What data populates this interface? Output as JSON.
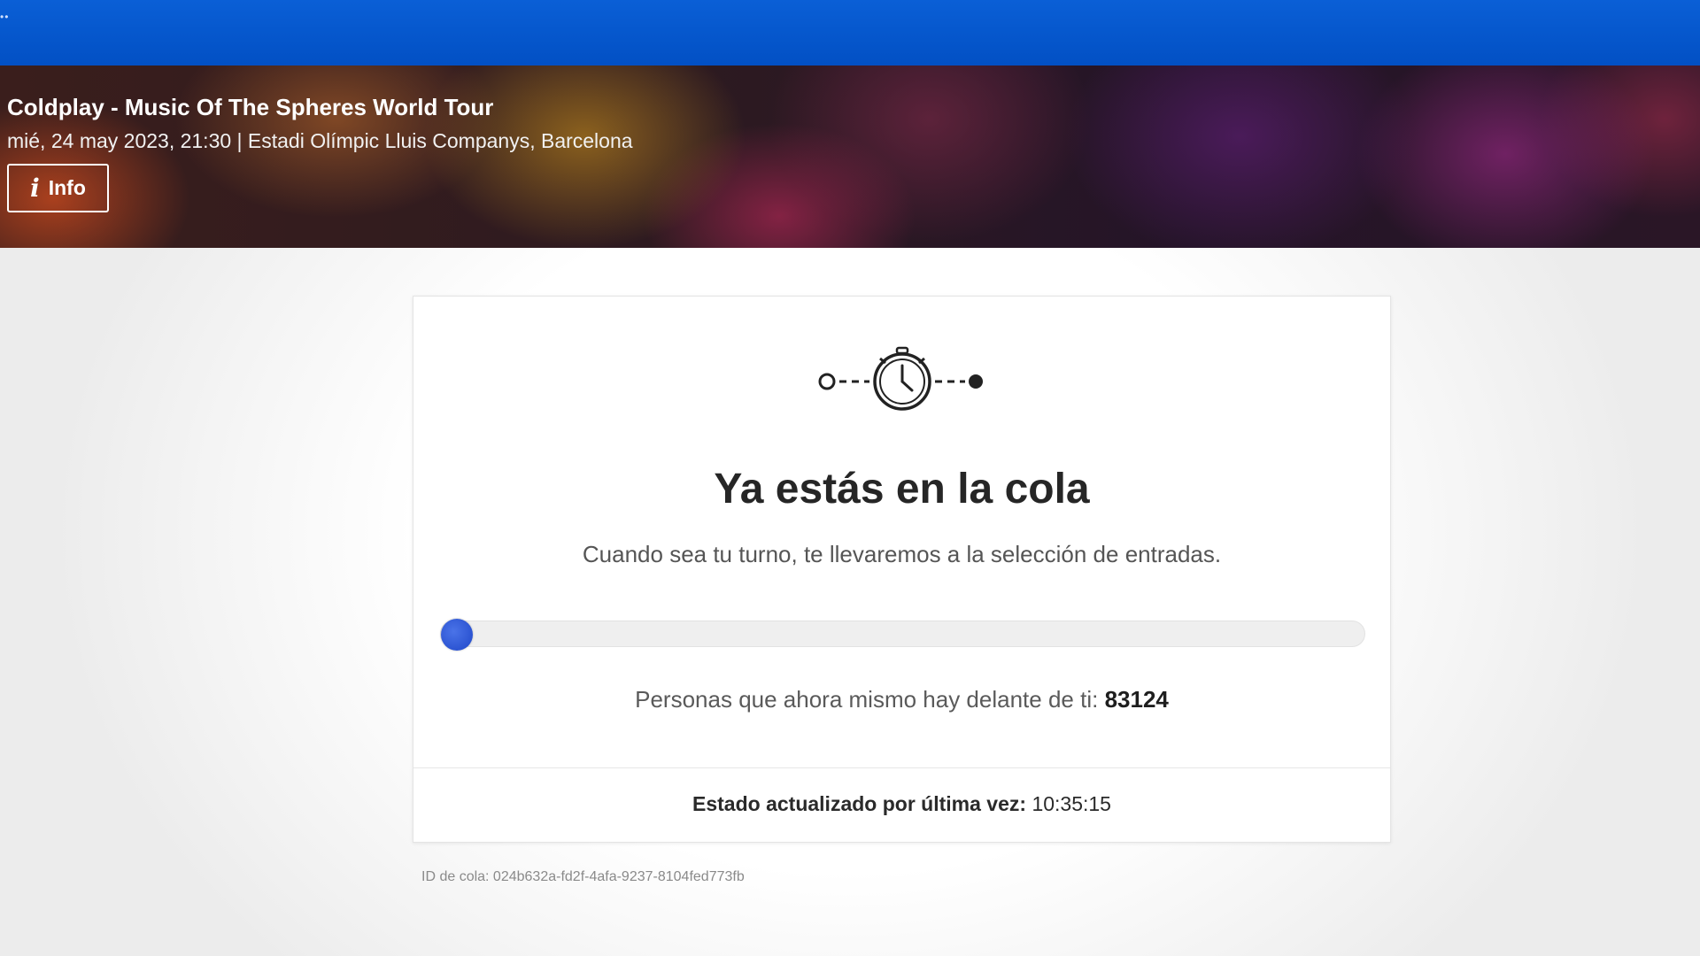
{
  "event": {
    "title": "Coldplay - Music Of The Spheres World Tour",
    "meta": "mié, 24 may 2023, 21:30 | Estadi Olímpic Lluis Companys, Barcelona",
    "info_button": "Info"
  },
  "queue": {
    "headline": "Ya estás en la cola",
    "subtitle": "Cuando sea tu turno, te llevaremos a la selección de entradas.",
    "progress": 0.02,
    "ahead_label": "Personas que ahora mismo hay delante de ti:",
    "ahead_count": "83124",
    "updated_label": "Estado actualizado por última vez:",
    "updated_time": "10:35:15",
    "queue_id": "ID de cola: 024b632a-fd2f-4afa-9237-8104fed773fb"
  },
  "colors": {
    "topbar": "#0250c4",
    "progress_knob": "#2a52d6"
  },
  "icons": {
    "queue_graphic": "stopwatch-icon"
  }
}
